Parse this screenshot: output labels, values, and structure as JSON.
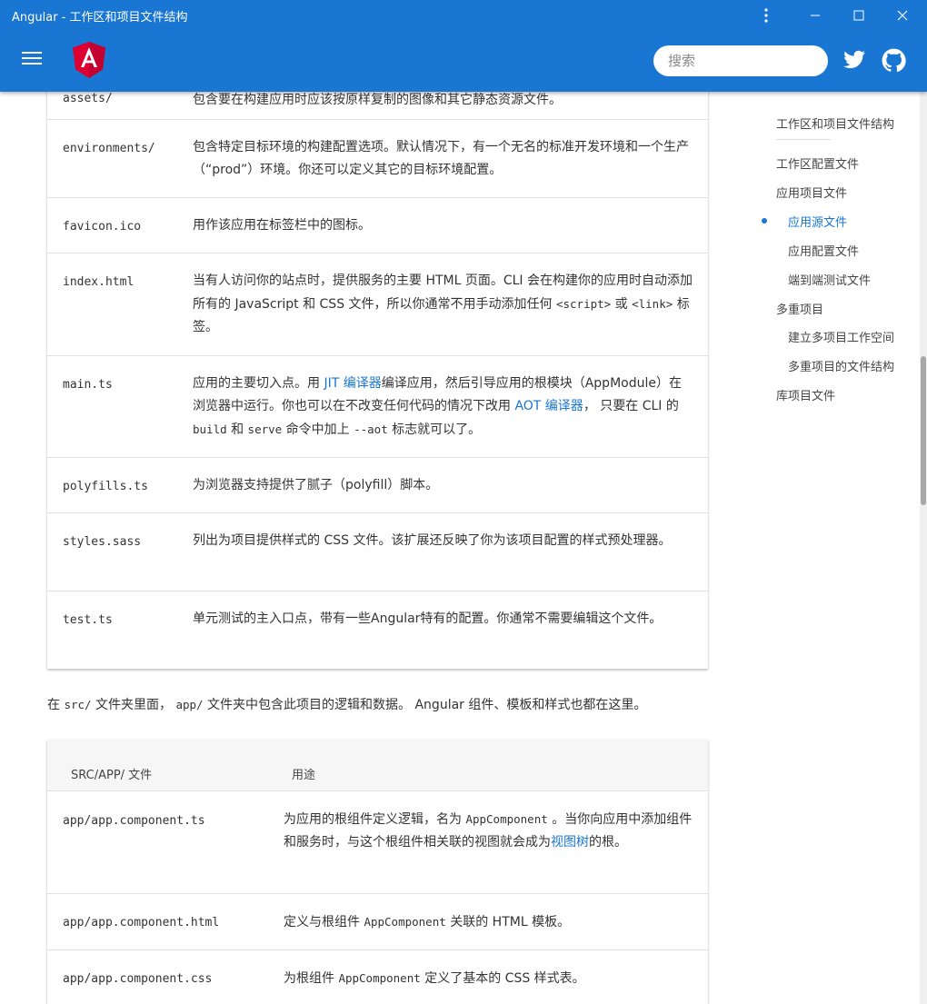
{
  "window": {
    "title": "Angular - 工作区和项目文件结构"
  },
  "search": {
    "placeholder": "搜索"
  },
  "icons": {
    "menu": "hamburger-icon",
    "logo": "angular-logo",
    "twitter": "twitter-icon",
    "github": "github-icon",
    "more": "more-vert-icon"
  },
  "colors": {
    "primary": "#1976d2",
    "link": "#1976d2"
  },
  "src_table": {
    "rows": [
      {
        "key": "assets/",
        "value": "包含要在构建应用时应该按原样复制的图像和其它静态资源文件。"
      },
      {
        "key": "environments/",
        "value": "包含特定目标环境的构建配置选项。默认情况下，有一个无名的标准开发环境和一个生产（“prod”）环境。你还可以定义其它的目标环境配置。"
      },
      {
        "key": "favicon.ico",
        "value": "用作该应用在标签栏中的图标。"
      },
      {
        "key": "index.html",
        "value_a": "当有人访问你的站点时，提供服务的主要 HTML 页面。CLI 会在构建你的应用时自动添加所有的 JavaScript 和 CSS 文件，所以你通常不用手动添加任何 ",
        "code_a": "<script>",
        "value_b": " 或 ",
        "code_b": "<link>",
        "value_c": " 标签。"
      },
      {
        "key": "main.ts",
        "value_a": "应用的主要切入点。用 ",
        "link_a": "JIT 编译器",
        "value_b": "编译应用，然后引导应用的根模块（AppModule）在浏览器中运行。你也可以在不改变任何代码的情况下改用 ",
        "link_b": "AOT 编译器",
        "value_c": "， 只要在 CLI 的 ",
        "code_a": "build",
        "value_d": " 和 ",
        "code_b": "serve",
        "value_e": " 命令中加上 ",
        "code_c": "--aot",
        "value_f": " 标志就可以了。"
      },
      {
        "key": "polyfills.ts",
        "value": "为浏览器支持提供了腻子（polyfill）脚本。"
      },
      {
        "key": "styles.sass",
        "value": "列出为项目提供样式的 CSS 文件。该扩展还反映了你为该项目配置的样式预处理器。"
      },
      {
        "key": "test.ts",
        "value": "单元测试的主入口点，带有一些Angular特有的配置。你通常不需要编辑这个文件。"
      }
    ]
  },
  "paragraph": {
    "a": "在 ",
    "code_a": "src/",
    "b": " 文件夹里面， ",
    "code_b": "app/",
    "c": " 文件夹中包含此项目的逻辑和数据。 Angular 组件、模板和样式也都在这里。"
  },
  "app_table": {
    "header": {
      "col1": "SRC/APP/ 文件",
      "col2": "用途"
    },
    "rows": [
      {
        "key": "app/app.component.ts",
        "value_a": "为应用的根组件定义逻辑，名为 ",
        "code_a": "AppComponent",
        "value_b": " 。当你向应用中添加组件和服务时，与这个根组件相关联的视图就会成为",
        "link_a": "视图树",
        "value_c": "的根。"
      },
      {
        "key": "app/app.component.html",
        "value_a": "定义与根组件 ",
        "code_a": "AppComponent",
        "value_b": " 关联的 HTML 模板。"
      },
      {
        "key": "app/app.component.css",
        "value_a": "为根组件 ",
        "code_a": "AppComponent",
        "value_b": " 定义了基本的 CSS 样式表。"
      }
    ]
  },
  "toc": {
    "items": [
      {
        "label": "工作区和项目文件结构"
      },
      {
        "label": "工作区配置文件"
      },
      {
        "label": "应用项目文件"
      },
      {
        "label": "应用源文件",
        "active": true
      },
      {
        "label": "应用配置文件"
      },
      {
        "label": "端到端测试文件"
      },
      {
        "label": "多重项目"
      },
      {
        "label": "建立多项目工作空间"
      },
      {
        "label": "多重项目的文件结构"
      },
      {
        "label": "库项目文件"
      }
    ]
  }
}
